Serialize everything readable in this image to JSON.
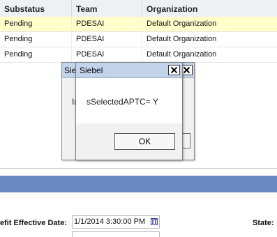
{
  "grid": {
    "columns": [
      "Substatus",
      "Team",
      "Organization"
    ],
    "rows": [
      {
        "substatus": "Pending",
        "team": "PDESAI",
        "organization": "Default Organization",
        "selected": true
      },
      {
        "substatus": "Pending",
        "team": "PDESAI",
        "organization": "Default Organization",
        "selected": false
      },
      {
        "substatus": "Pending",
        "team": "PDESAI",
        "organization": "Default Organization",
        "selected": false
      }
    ]
  },
  "dialog_back": {
    "title": "Sie",
    "body_fragment": "Ir"
  },
  "dialog_front": {
    "title": "Siebel",
    "message": "sSelectedAPTC= Y",
    "ok_label": "OK"
  },
  "form": {
    "benefit_effective_date_label": "efit Effective Date:",
    "benefit_effective_date_value": "1/1/2014 3:30:00 PM",
    "state_label": "State:"
  },
  "colors": {
    "header_bg": "#eef0f3",
    "selected_row": "#ffffcc",
    "blue_bar": "#6987c1",
    "dialog_title": "#c3d4ea"
  }
}
